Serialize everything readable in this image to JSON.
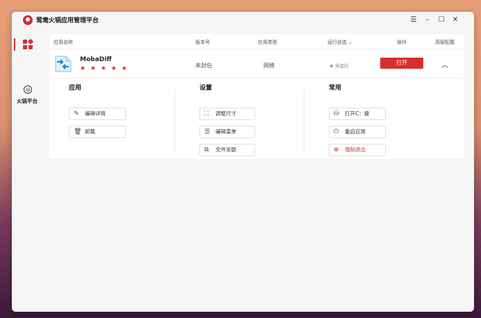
{
  "window": {
    "title": "鸳鸯火锅应用管理平台",
    "controls": [
      "menu-icon",
      "minimize-icon",
      "maximize-icon",
      "close-icon"
    ]
  },
  "sidebar": {
    "items": [
      {
        "label": "",
        "icon": "grid-icon",
        "active": true
      },
      {
        "label": "火锅平台",
        "icon": "hotpot-icon",
        "active": false
      }
    ]
  },
  "table": {
    "headers": {
      "name": "应用名称",
      "version": "版本号",
      "type": "应用类型",
      "status": "运行状态",
      "action": "操作",
      "advanced": "高级配置"
    },
    "app": {
      "name": "MobaDiff",
      "rating": "★ ★ ★ ★ ★",
      "version": "未封包",
      "type": "网络",
      "status": "未运行",
      "open_label": "打开"
    }
  },
  "sections": {
    "app": {
      "title": "应用",
      "buttons": [
        "编辑详情",
        "卸载"
      ]
    },
    "settings": {
      "title": "设置",
      "buttons": [
        "调整尺寸",
        "编辑菜单",
        "文件关联"
      ]
    },
    "common": {
      "title": "常用",
      "buttons": [
        "打开C：盘",
        "重启应用",
        "强制退出"
      ]
    }
  },
  "colors": {
    "accent": "#d32f2f"
  }
}
